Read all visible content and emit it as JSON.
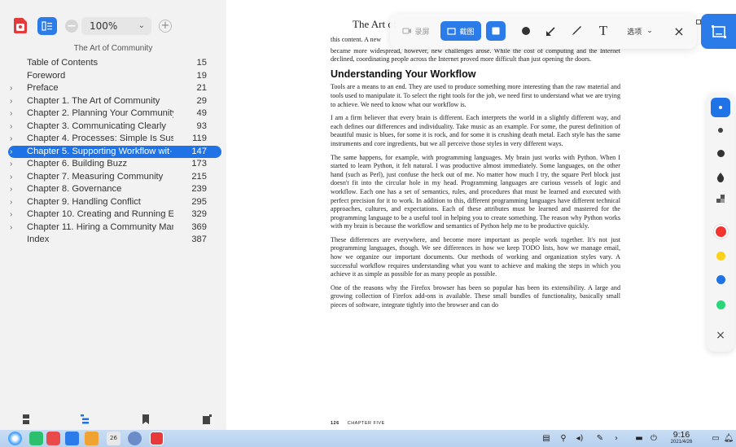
{
  "app": {
    "doc_title": "The Art of",
    "zoom": "100%"
  },
  "sidebar": {
    "book_title": "The Art of Community",
    "toc": [
      {
        "title": "Table of Contents",
        "page": "15",
        "expandable": false,
        "active": false
      },
      {
        "title": "Foreword",
        "page": "19",
        "expandable": false,
        "active": false
      },
      {
        "title": "Preface",
        "page": "21",
        "expandable": true,
        "active": false
      },
      {
        "title": "Chapter 1. The Art of Community",
        "page": "29",
        "expandable": true,
        "active": false
      },
      {
        "title": "Chapter 2. Planning Your Community",
        "page": "49",
        "expandable": true,
        "active": false
      },
      {
        "title": "Chapter 3. Communicating Clearly",
        "page": "93",
        "expandable": true,
        "active": false
      },
      {
        "title": "Chapter 4. Processes: Simple Is Susta···",
        "page": "119",
        "expandable": true,
        "active": false
      },
      {
        "title": "Chapter 5. Supporting Workflow wit···",
        "page": "147",
        "expandable": true,
        "active": true
      },
      {
        "title": "Chapter 6. Building Buzz",
        "page": "173",
        "expandable": true,
        "active": false
      },
      {
        "title": "Chapter 7. Measuring Community",
        "page": "215",
        "expandable": true,
        "active": false
      },
      {
        "title": "Chapter 8. Governance",
        "page": "239",
        "expandable": true,
        "active": false
      },
      {
        "title": "Chapter 9. Handling Conflict",
        "page": "295",
        "expandable": true,
        "active": false
      },
      {
        "title": "Chapter 10. Creating and Running Ev···",
        "page": "329",
        "expandable": true,
        "active": false
      },
      {
        "title": "Chapter 11. Hiring a Community Man···",
        "page": "369",
        "expandable": true,
        "active": false
      },
      {
        "title": "Index",
        "page": "387",
        "expandable": false,
        "active": false
      }
    ]
  },
  "page": {
    "para0": "this content. A new",
    "para1": "became more widespread, however, new challenges arose. While the cost of computing and the Internet declined, coordinating people across the Internet proved more difficult than just opening the doors.",
    "heading": "Understanding Your Workflow",
    "para2": "Tools are a means to an end. They are used to produce something more interesting than the raw material and tools used to manipulate it. To select the right tools for the job, we need first to understand what we are trying to achieve. We need to know what our workflow is.",
    "para3": "I am a firm believer that every brain is different. Each interprets the world in a slightly different way, and each defines our differences and individuality. Take music as an example. For some, the purest definition of beautiful music is blues, for some it is rock, and for some it is crushing death metal. Each style has the same instruments and core ingredients, but we all perceive those styles in very different ways.",
    "para4": "The same happens, for example, with programming languages. My brain just works with Python. When I started to learn Python, it felt natural. I was productive almost immediately. Some languages, on the other hand (such as Perl), just confuse the heck out of me. No matter how much I try, the square Perl block just doesn't fit into the circular hole in my head. Programming languages are curious vessels of logic and workflow. Each one has a set of semantics, rules, and procedures that must be learned and executed with perfect precision for it to work. In addition to this, different programming languages have different technical approaches, cultures, and expectations. Each of these attributes must be learned and mastered for the programming language to be a useful tool in helping you to create something. The reason why Python works with my brain is because the workflow and semantics of Python help me to be productive quickly.",
    "para5": "These differences are everywhere, and become more important as people work together. It's not just programming languages, though. We see differences in how we keep TODO lists, how we manage email, how we organize our important documents. Our methods of working and organization styles vary. A successful workflow requires understanding what you want to achieve and making the steps in which you achieve it as simple as possible for as many people as possible.",
    "para6": "One of the reasons why the Firefox browser has been so popular has been its extensibility. A large and growing collection of Firefox add-ons is available. These small bundles of functionality, basically small pieces of software, integrate tightly into the browser and can do",
    "footer_num": "126",
    "footer_chapter": "CHAPTER FIVE"
  },
  "screenshot_toolbar": {
    "record_label": "录屏",
    "shot_label": "截图",
    "text_tool": "T",
    "options_label": "选项",
    "close_glyph": "×"
  },
  "color_panel": {
    "close_glyph": "×",
    "colors": [
      "#f3352f",
      "#fcd11a",
      "#1f73e6",
      "#2bd67b"
    ]
  },
  "taskbar": {
    "time": "9:16",
    "date": "2021/4/26"
  }
}
